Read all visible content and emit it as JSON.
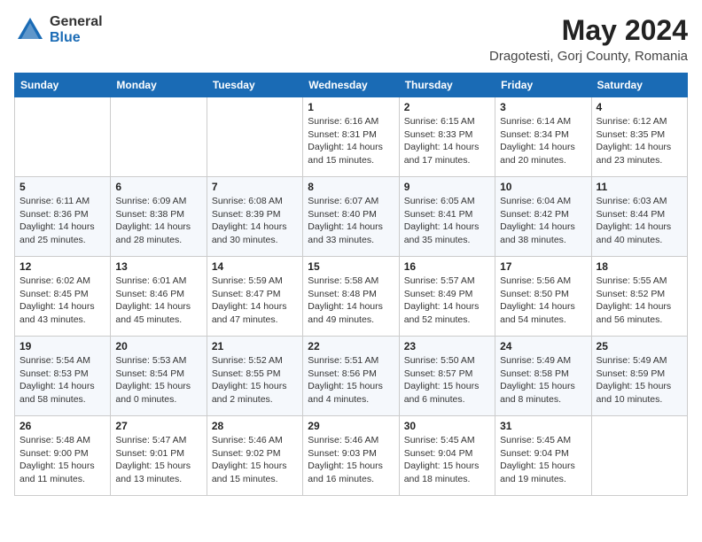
{
  "header": {
    "logo_general": "General",
    "logo_blue": "Blue",
    "title": "May 2024",
    "location": "Dragotesti, Gorj County, Romania"
  },
  "weekdays": [
    "Sunday",
    "Monday",
    "Tuesday",
    "Wednesday",
    "Thursday",
    "Friday",
    "Saturday"
  ],
  "weeks": [
    [
      {
        "day": "",
        "info": ""
      },
      {
        "day": "",
        "info": ""
      },
      {
        "day": "",
        "info": ""
      },
      {
        "day": "1",
        "info": "Sunrise: 6:16 AM\nSunset: 8:31 PM\nDaylight: 14 hours\nand 15 minutes."
      },
      {
        "day": "2",
        "info": "Sunrise: 6:15 AM\nSunset: 8:33 PM\nDaylight: 14 hours\nand 17 minutes."
      },
      {
        "day": "3",
        "info": "Sunrise: 6:14 AM\nSunset: 8:34 PM\nDaylight: 14 hours\nand 20 minutes."
      },
      {
        "day": "4",
        "info": "Sunrise: 6:12 AM\nSunset: 8:35 PM\nDaylight: 14 hours\nand 23 minutes."
      }
    ],
    [
      {
        "day": "5",
        "info": "Sunrise: 6:11 AM\nSunset: 8:36 PM\nDaylight: 14 hours\nand 25 minutes."
      },
      {
        "day": "6",
        "info": "Sunrise: 6:09 AM\nSunset: 8:38 PM\nDaylight: 14 hours\nand 28 minutes."
      },
      {
        "day": "7",
        "info": "Sunrise: 6:08 AM\nSunset: 8:39 PM\nDaylight: 14 hours\nand 30 minutes."
      },
      {
        "day": "8",
        "info": "Sunrise: 6:07 AM\nSunset: 8:40 PM\nDaylight: 14 hours\nand 33 minutes."
      },
      {
        "day": "9",
        "info": "Sunrise: 6:05 AM\nSunset: 8:41 PM\nDaylight: 14 hours\nand 35 minutes."
      },
      {
        "day": "10",
        "info": "Sunrise: 6:04 AM\nSunset: 8:42 PM\nDaylight: 14 hours\nand 38 minutes."
      },
      {
        "day": "11",
        "info": "Sunrise: 6:03 AM\nSunset: 8:44 PM\nDaylight: 14 hours\nand 40 minutes."
      }
    ],
    [
      {
        "day": "12",
        "info": "Sunrise: 6:02 AM\nSunset: 8:45 PM\nDaylight: 14 hours\nand 43 minutes."
      },
      {
        "day": "13",
        "info": "Sunrise: 6:01 AM\nSunset: 8:46 PM\nDaylight: 14 hours\nand 45 minutes."
      },
      {
        "day": "14",
        "info": "Sunrise: 5:59 AM\nSunset: 8:47 PM\nDaylight: 14 hours\nand 47 minutes."
      },
      {
        "day": "15",
        "info": "Sunrise: 5:58 AM\nSunset: 8:48 PM\nDaylight: 14 hours\nand 49 minutes."
      },
      {
        "day": "16",
        "info": "Sunrise: 5:57 AM\nSunset: 8:49 PM\nDaylight: 14 hours\nand 52 minutes."
      },
      {
        "day": "17",
        "info": "Sunrise: 5:56 AM\nSunset: 8:50 PM\nDaylight: 14 hours\nand 54 minutes."
      },
      {
        "day": "18",
        "info": "Sunrise: 5:55 AM\nSunset: 8:52 PM\nDaylight: 14 hours\nand 56 minutes."
      }
    ],
    [
      {
        "day": "19",
        "info": "Sunrise: 5:54 AM\nSunset: 8:53 PM\nDaylight: 14 hours\nand 58 minutes."
      },
      {
        "day": "20",
        "info": "Sunrise: 5:53 AM\nSunset: 8:54 PM\nDaylight: 15 hours\nand 0 minutes."
      },
      {
        "day": "21",
        "info": "Sunrise: 5:52 AM\nSunset: 8:55 PM\nDaylight: 15 hours\nand 2 minutes."
      },
      {
        "day": "22",
        "info": "Sunrise: 5:51 AM\nSunset: 8:56 PM\nDaylight: 15 hours\nand 4 minutes."
      },
      {
        "day": "23",
        "info": "Sunrise: 5:50 AM\nSunset: 8:57 PM\nDaylight: 15 hours\nand 6 minutes."
      },
      {
        "day": "24",
        "info": "Sunrise: 5:49 AM\nSunset: 8:58 PM\nDaylight: 15 hours\nand 8 minutes."
      },
      {
        "day": "25",
        "info": "Sunrise: 5:49 AM\nSunset: 8:59 PM\nDaylight: 15 hours\nand 10 minutes."
      }
    ],
    [
      {
        "day": "26",
        "info": "Sunrise: 5:48 AM\nSunset: 9:00 PM\nDaylight: 15 hours\nand 11 minutes."
      },
      {
        "day": "27",
        "info": "Sunrise: 5:47 AM\nSunset: 9:01 PM\nDaylight: 15 hours\nand 13 minutes."
      },
      {
        "day": "28",
        "info": "Sunrise: 5:46 AM\nSunset: 9:02 PM\nDaylight: 15 hours\nand 15 minutes."
      },
      {
        "day": "29",
        "info": "Sunrise: 5:46 AM\nSunset: 9:03 PM\nDaylight: 15 hours\nand 16 minutes."
      },
      {
        "day": "30",
        "info": "Sunrise: 5:45 AM\nSunset: 9:04 PM\nDaylight: 15 hours\nand 18 minutes."
      },
      {
        "day": "31",
        "info": "Sunrise: 5:45 AM\nSunset: 9:04 PM\nDaylight: 15 hours\nand 19 minutes."
      },
      {
        "day": "",
        "info": ""
      }
    ]
  ]
}
